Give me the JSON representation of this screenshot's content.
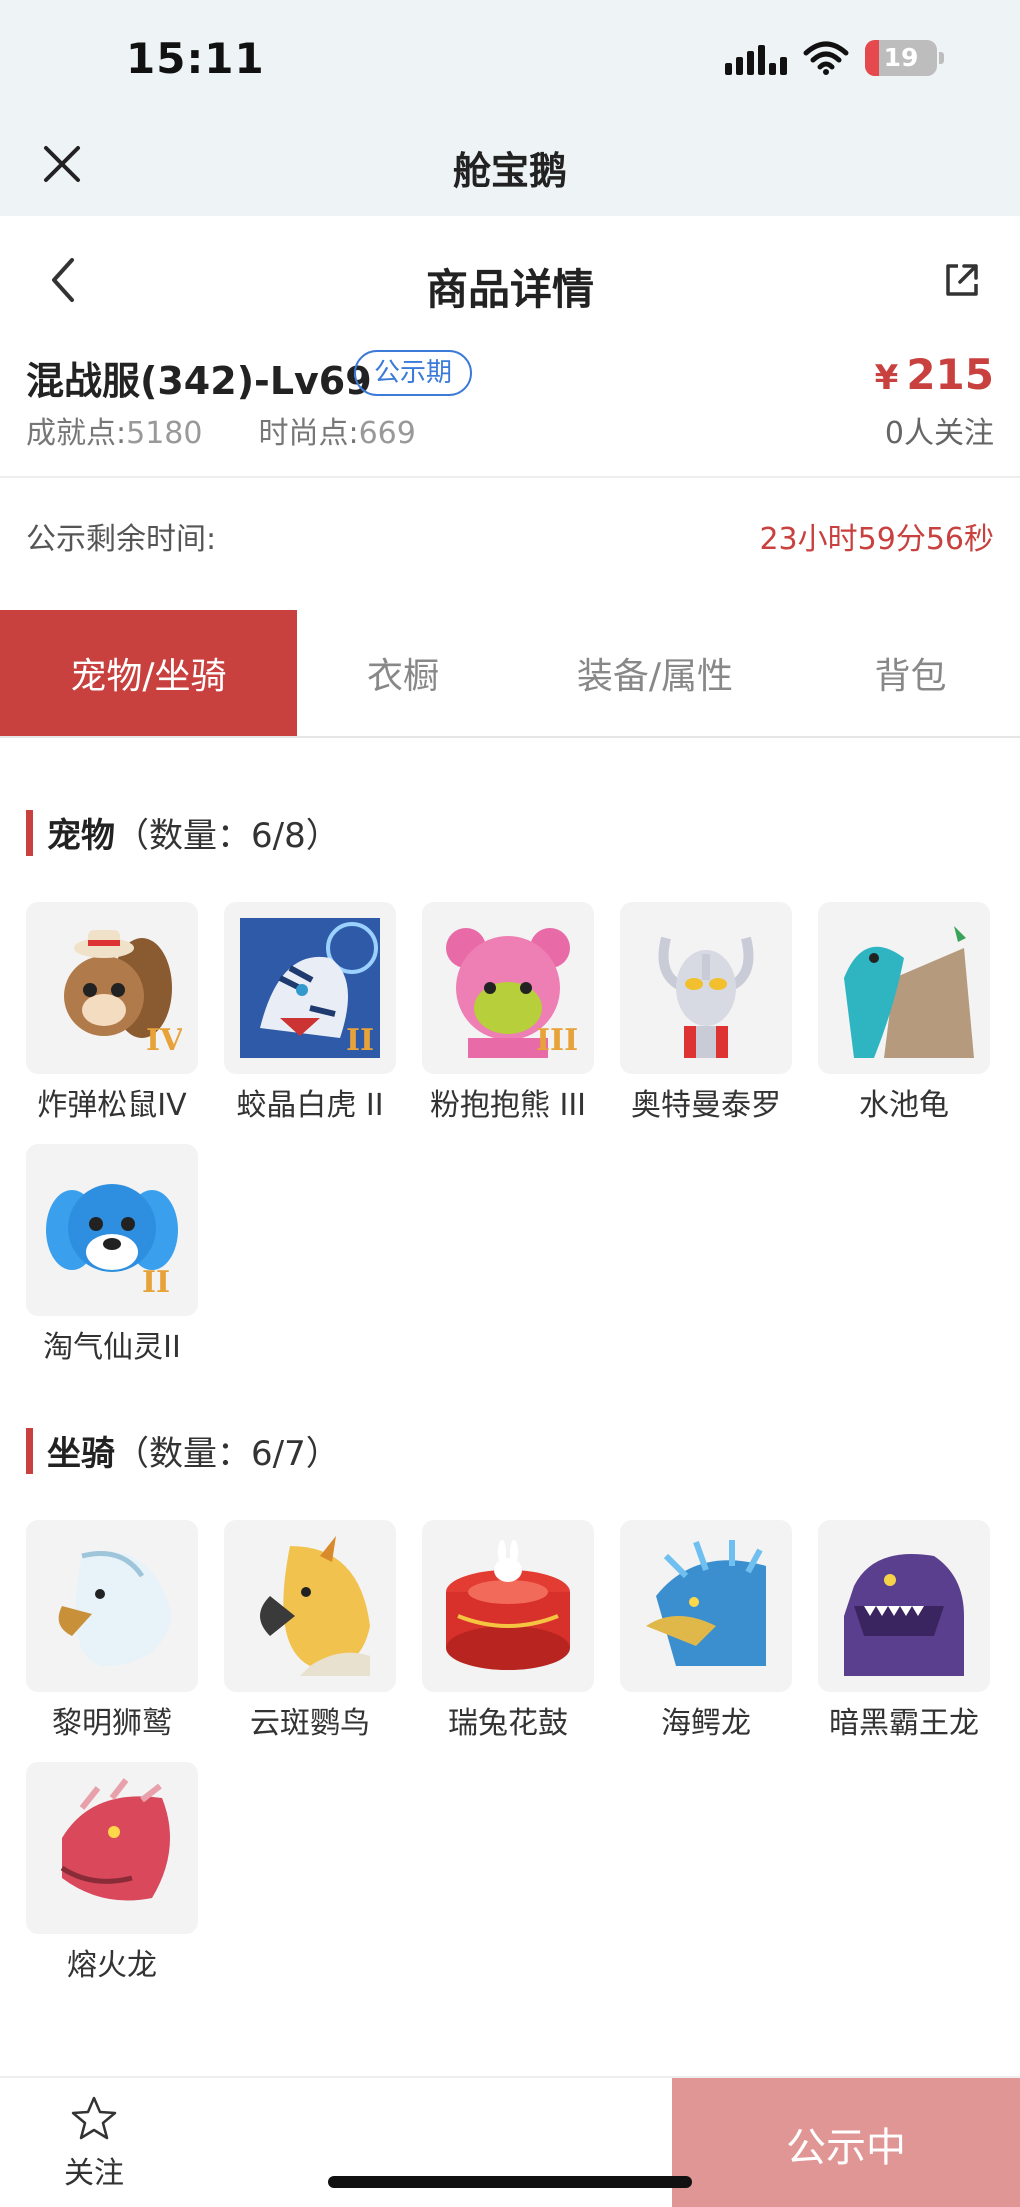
{
  "status_bar": {
    "time": "15:11",
    "battery": "19",
    "battery_level": 0.19
  },
  "app_bar": {
    "title": "舱宝鹅",
    "close_icon": "close-icon"
  },
  "nav": {
    "title": "商品详情",
    "back_icon": "chevron-left-icon",
    "share_icon": "share-icon"
  },
  "product": {
    "title": "混战服(342)-Lv69",
    "badge": "公示期",
    "price_symbol": "¥",
    "price": "215",
    "achievement_label": "成就点:",
    "achievement_value": "5180",
    "fashion_label": "时尚点:",
    "fashion_value": "669",
    "followers": "0人关注"
  },
  "countdown": {
    "label": "公示剩余时间:",
    "value": "23小时59分56秒"
  },
  "tabs": [
    {
      "label": "宠物/坐骑",
      "active": true
    },
    {
      "label": "衣橱",
      "active": false
    },
    {
      "label": "装备/属性",
      "active": false
    },
    {
      "label": "背包",
      "active": false
    }
  ],
  "pets": {
    "title": "宠物",
    "count": "（数量：6/8）",
    "items": [
      {
        "name": "炸弹松鼠IV",
        "icon": "squirrel-icon",
        "color": "#b07a4a"
      },
      {
        "name": "蛟晶白虎 II",
        "icon": "tiger-icon",
        "color": "#4a78c4"
      },
      {
        "name": "粉抱抱熊 III",
        "icon": "bear-icon",
        "color": "#e86aa6"
      },
      {
        "name": "奥特曼泰罗",
        "icon": "ultraman-icon",
        "color": "#c9cbd6"
      },
      {
        "name": "水池龟",
        "icon": "turtle-icon",
        "color": "#2fb4c2"
      },
      {
        "name": "淘气仙灵II",
        "icon": "fairy-icon",
        "color": "#2e8fe0"
      }
    ]
  },
  "mounts": {
    "title": "坐骑",
    "count": "（数量：6/7）",
    "items": [
      {
        "name": "黎明狮鹫",
        "icon": "griffin-icon",
        "color": "#cfe6f1"
      },
      {
        "name": "云斑鹦鸟",
        "icon": "parrot-icon",
        "color": "#f2c24e"
      },
      {
        "name": "瑞兔花鼓",
        "icon": "drum-icon",
        "color": "#d8302a"
      },
      {
        "name": "海鳄龙",
        "icon": "sea-dragon-icon",
        "color": "#3c8fcf"
      },
      {
        "name": "暗黑霸王龙",
        "icon": "trex-icon",
        "color": "#5b3f8f"
      },
      {
        "name": "熔火龙",
        "icon": "fire-dragon-icon",
        "color": "#d9485b"
      }
    ]
  },
  "bottom": {
    "follow_label": "关注",
    "follow_icon": "star-icon",
    "status_label": "公示中"
  }
}
